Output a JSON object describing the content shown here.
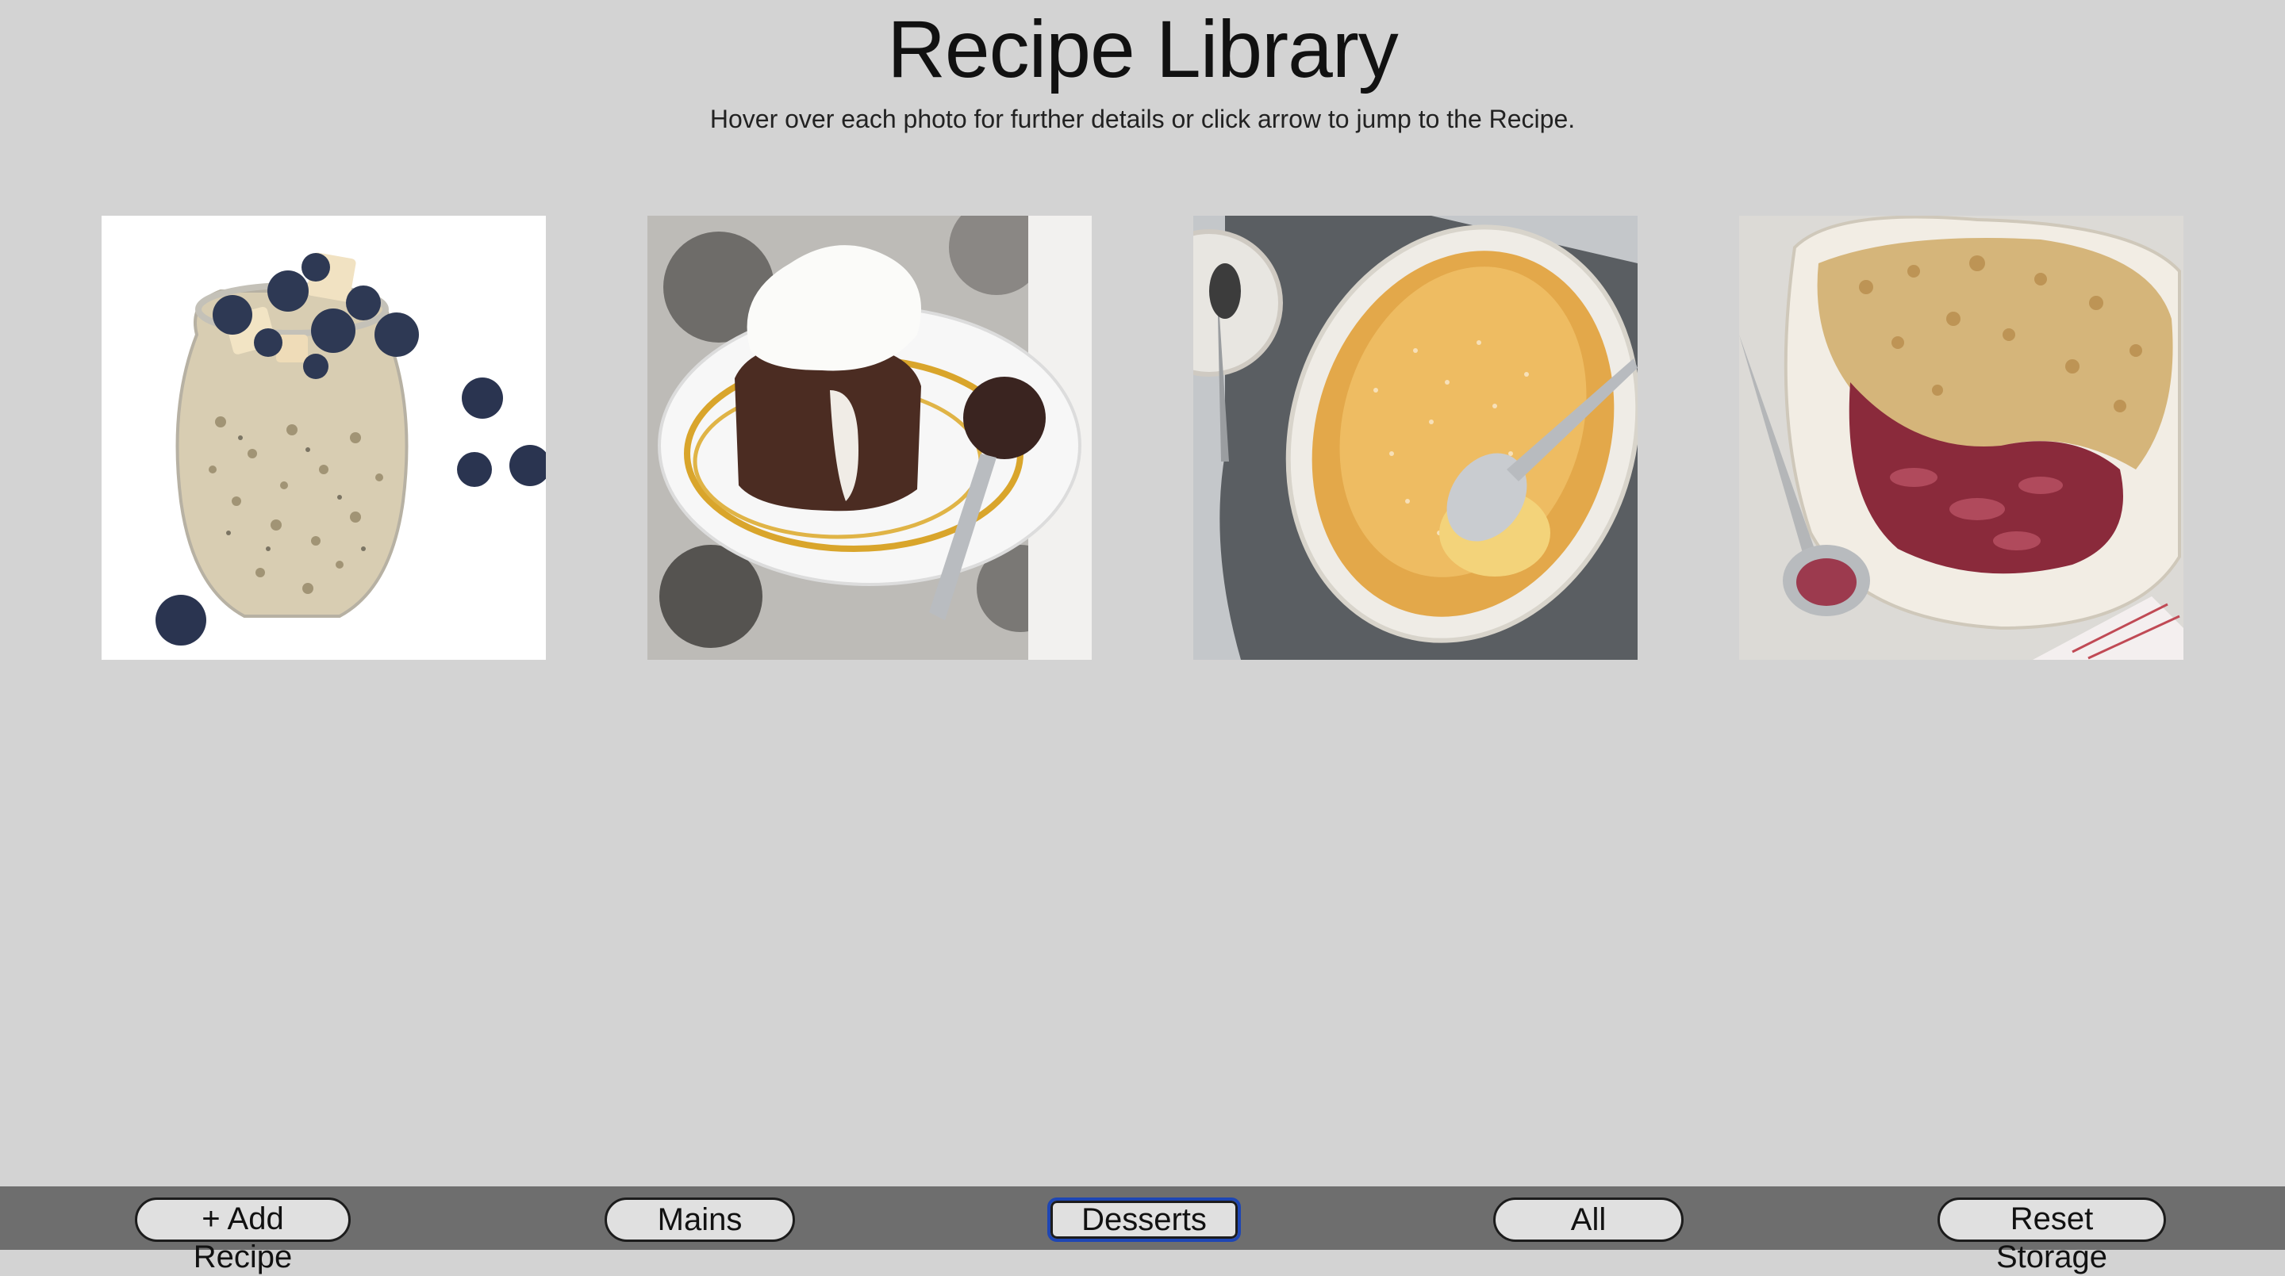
{
  "header": {
    "title": "Recipe Library",
    "subtitle": "Hover over each photo for further details or click arrow to jump to the Recipe."
  },
  "recipes": [
    {
      "name": "overnight-oats-photo"
    },
    {
      "name": "chocolate-lava-cake-photo"
    },
    {
      "name": "baked-custard-pudding-photo"
    },
    {
      "name": "rhubarb-crumble-photo"
    }
  ],
  "nav": {
    "add_label": "+ Add Recipe",
    "mains_label": "Mains",
    "desserts_label": "Desserts",
    "all_label": "All",
    "reset_label": "Reset Storage",
    "active": "Desserts"
  },
  "colors": {
    "background": "#d3d3d3",
    "bottom_bar": "#6e6e6e",
    "active_outline": "#1e46b4"
  }
}
